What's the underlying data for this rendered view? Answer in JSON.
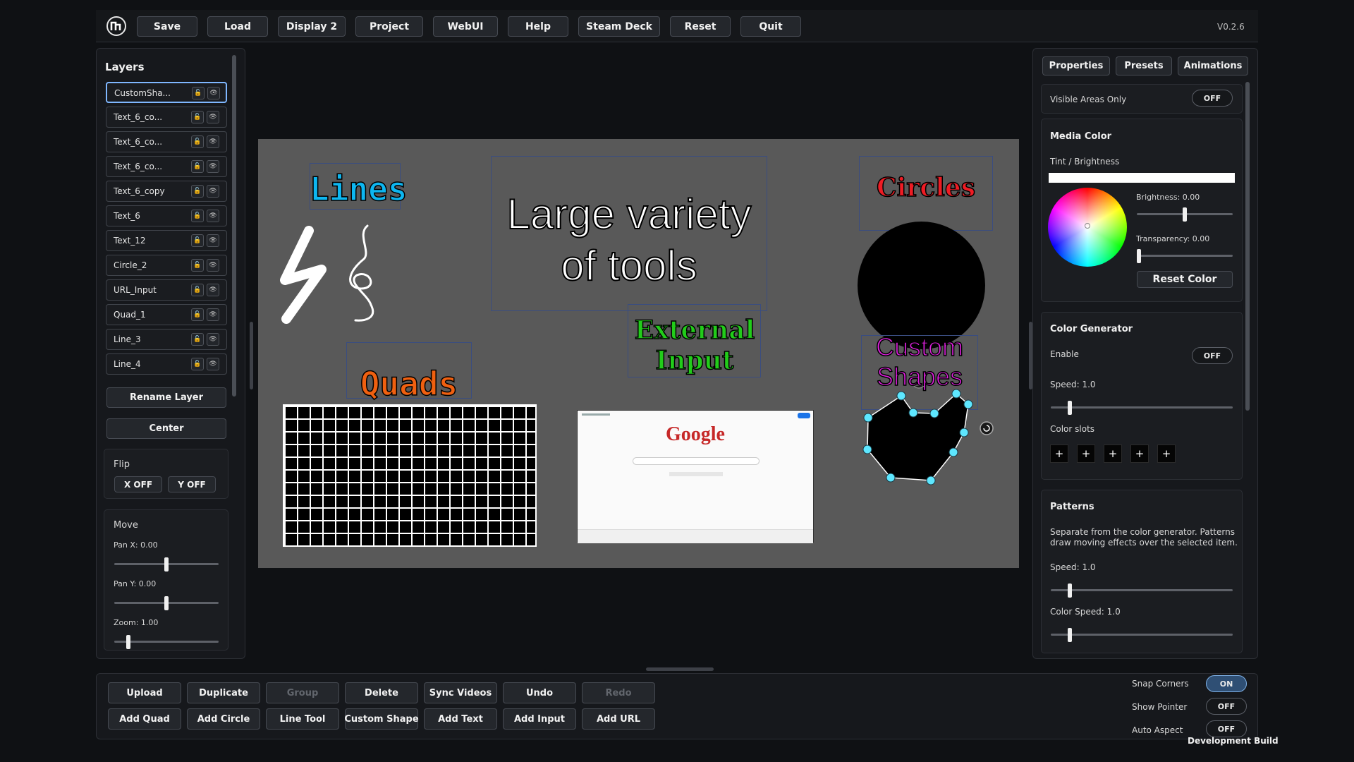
{
  "toolbar": {
    "buttons": [
      "Save",
      "Load",
      "Display 2",
      "Project",
      "WebUI",
      "Help",
      "Steam Deck",
      "Reset",
      "Quit"
    ],
    "version": "V0.2.6"
  },
  "layers": {
    "title": "Layers",
    "items": [
      "CustomSha...",
      "Text_6_co...",
      "Text_6_co...",
      "Text_6_co...",
      "Text_6_copy",
      "Text_6",
      "Text_12",
      "Circle_2",
      "URL_Input",
      "Quad_1",
      "Line_3",
      "Line_4"
    ],
    "rename_label": "Rename Layer",
    "center_label": "Center",
    "flip": {
      "title": "Flip",
      "x_label": "X OFF",
      "y_label": "Y OFF"
    },
    "move": {
      "title": "Move",
      "pan_x": "Pan X: 0.00",
      "pan_y": "Pan Y: 0.00",
      "zoom": "Zoom: 1.00",
      "pan_x_value": 0.5,
      "pan_y_value": 0.5,
      "zoom_value": 0.12
    }
  },
  "canvas": {
    "lines_title": "Lines",
    "main_title_1": "Large variety",
    "main_title_2": "of tools",
    "circles_title": "Circles",
    "quads_title": "Quads",
    "external_1": "External",
    "external_2": "Input",
    "custom_1": "Custom",
    "custom_2": "Shapes",
    "google_logo": "Google"
  },
  "right": {
    "tabs": [
      "Properties",
      "Presets",
      "Animations"
    ],
    "visible_areas_label": "Visible Areas Only",
    "visible_areas_state": "OFF",
    "media_color": {
      "title": "Media Color",
      "tint_label": "Tint / Brightness",
      "brightness": "Brightness: 0.00",
      "transparency": "Transparency: 0.00",
      "reset_label": "Reset Color"
    },
    "color_gen": {
      "title": "Color Generator",
      "enable_label": "Enable",
      "enable_state": "OFF",
      "speed": "Speed: 1.0",
      "slots_label": "Color slots",
      "slot_symbol": "+"
    },
    "patterns": {
      "title": "Patterns",
      "desc_1": "Separate from the color generator. Patterns",
      "desc_2": "draw moving effects over the selected item.",
      "speed": "Speed: 1.0",
      "color_speed": "Color Speed: 1.0"
    }
  },
  "bottom": {
    "row1": [
      "Upload",
      "Duplicate",
      "Group",
      "Delete",
      "Sync Videos",
      "Undo",
      "Redo"
    ],
    "row2": [
      "Add Quad",
      "Add Circle",
      "Line Tool",
      "Custom Shape",
      "Add Text",
      "Add Input",
      "Add URL"
    ],
    "snap_corners_label": "Snap Corners",
    "snap_corners_state": "ON",
    "show_pointer_label": "Show Pointer",
    "show_pointer_state": "OFF",
    "auto_aspect_label": "Auto Aspect",
    "auto_aspect_state": "OFF",
    "dev_build": "Development Build"
  }
}
